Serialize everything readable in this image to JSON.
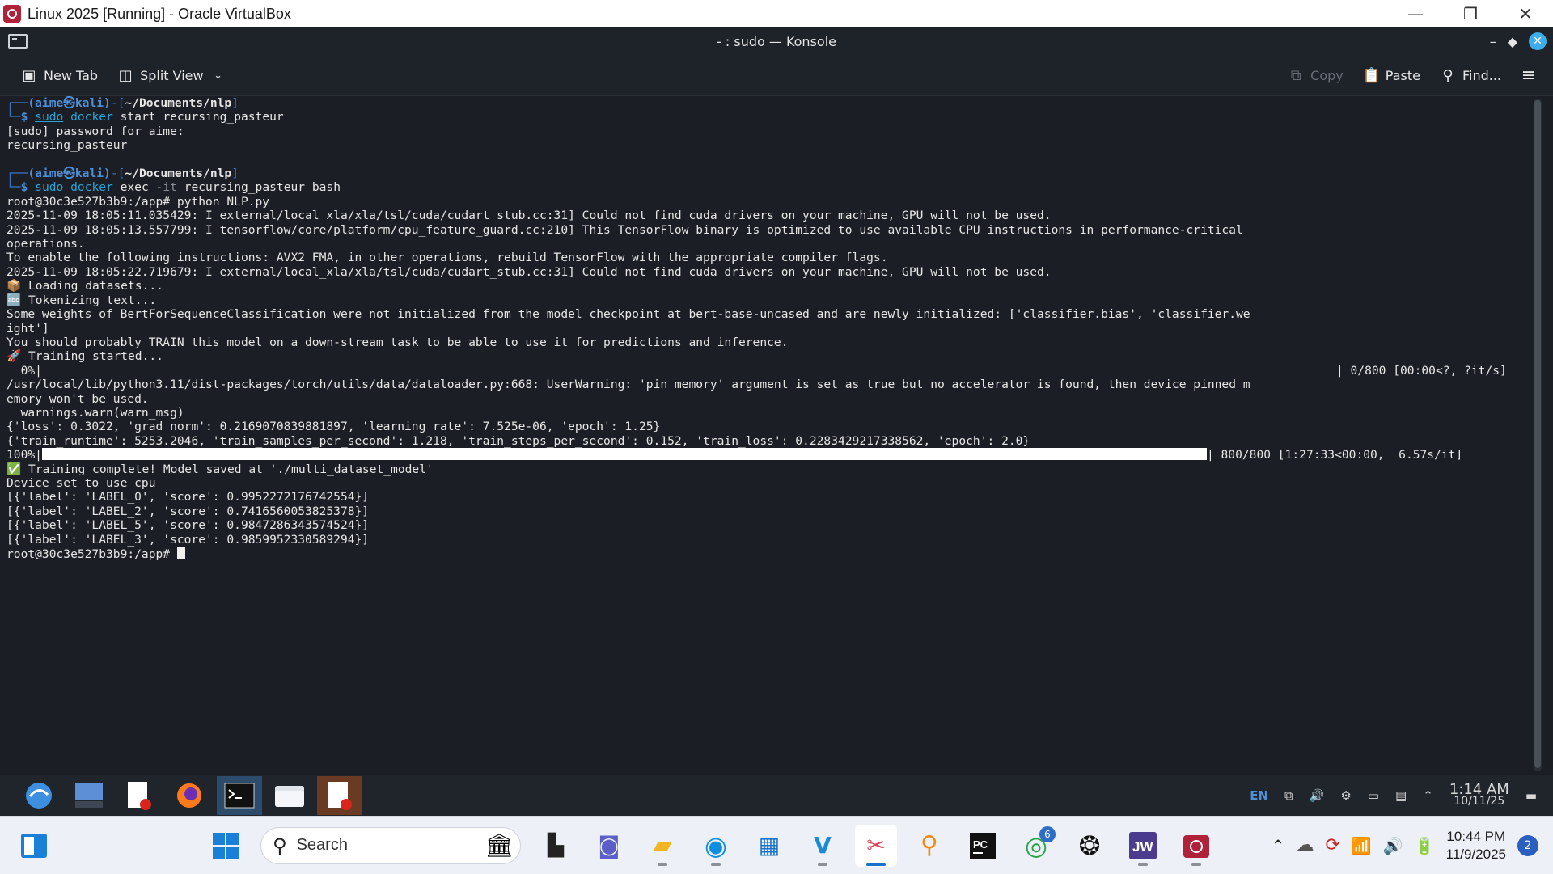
{
  "host_window": {
    "title": "Linux 2025 [Running] - Oracle VirtualBox",
    "minimize_icon": "minimize-icon",
    "restore_icon": "restore-icon",
    "close_icon": "close-icon"
  },
  "konsole": {
    "title": "- : sudo — Konsole",
    "toolbar": {
      "new_tab": "New Tab",
      "split_view": "Split View",
      "copy": "Copy",
      "paste": "Paste",
      "find": "Find..."
    }
  },
  "terminal": {
    "prompt_user": "(aime㉿kali)",
    "prompt_cwd": "~/Documents/nlp",
    "cmd1_rest": " start recursing_pasteur",
    "out1": "[sudo] password for aime:",
    "out2": "recursing_pasteur",
    "cmd2_flag": "-it",
    "cmd2_rest": " recursing_pasteur bash",
    "lines": [
      "root@30c3e527b3b9:/app# python NLP.py",
      "2025-11-09 18:05:11.035429: I external/local_xla/xla/tsl/cuda/cudart_stub.cc:31] Could not find cuda drivers on your machine, GPU will not be used.",
      "2025-11-09 18:05:13.557799: I tensorflow/core/platform/cpu_feature_guard.cc:210] This TensorFlow binary is optimized to use available CPU instructions in performance-critical",
      "operations.",
      "To enable the following instructions: AVX2 FMA, in other operations, rebuild TensorFlow with the appropriate compiler flags.",
      "2025-11-09 18:05:22.719679: I external/local_xla/xla/tsl/cuda/cudart_stub.cc:31] Could not find cuda drivers on your machine, GPU will not be used.",
      "📦 Loading datasets...",
      "🔤 Tokenizing text...",
      "Some weights of BertForSequenceClassification were not initialized from the model checkpoint at bert-base-uncased and are newly initialized: ['classifier.bias', 'classifier.we",
      "ight']",
      "You should probably TRAIN this model on a down-stream task to be able to use it for predictions and inference.",
      "🚀 Training started..."
    ],
    "progress0_left": "  0%|",
    "progress0_right": "| 0/800 [00:00<?, ?it/s]",
    "lines_after_progress0": [
      "/usr/local/lib/python3.11/dist-packages/torch/utils/data/dataloader.py:668: UserWarning: 'pin_memory' argument is set as true but no accelerator is found, then device pinned m",
      "emory won't be used.",
      "  warnings.warn(warn_msg)",
      "{'loss': 0.3022, 'grad_norm': 0.2169070839881897, 'learning_rate': 7.525e-06, 'epoch': 1.25}",
      "{'train_runtime': 5253.2046, 'train_samples_per_second': 1.218, 'train_steps_per_second': 0.152, 'train_loss': 0.2283429217338562, 'epoch': 2.0}"
    ],
    "progress100_left": "100%|",
    "progress100_right": "| 800/800 [1:27:33<00:00,  6.57s/it]",
    "progress100_fraction": 1.0,
    "lines_final": [
      "✅ Training complete! Model saved at './multi_dataset_model'",
      "Device set to use cpu",
      "[{'label': 'LABEL_0', 'score': 0.9952272176742554}]",
      "[{'label': 'LABEL_2', 'score': 0.7416560053825378}]",
      "[{'label': 'LABEL_5', 'score': 0.9847286343574524}]",
      "[{'label': 'LABEL_3', 'score': 0.9859952330589294}]"
    ],
    "final_prompt": "root@30c3e527b3b9:/app# "
  },
  "guest_panel": {
    "apps": [
      "kde-menu-icon",
      "desktop-icon",
      "text-editor-icon",
      "firefox-icon",
      "terminal-icon",
      "file-manager-icon",
      "text-editor-icon"
    ],
    "lang": "EN",
    "time": "1:14 AM",
    "date": "10/11/25"
  },
  "windows_taskbar": {
    "search_label": "Search",
    "whatsapp_badge": "6",
    "time": "10:44 PM",
    "date": "11/9/2025",
    "notifications": "2"
  }
}
